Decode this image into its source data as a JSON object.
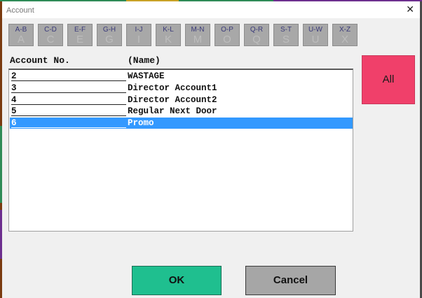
{
  "dialog": {
    "title": "Account",
    "close_glyph": "✕"
  },
  "alphabet_buttons": [
    {
      "range": "A-B",
      "letter": "A"
    },
    {
      "range": "C-D",
      "letter": "C"
    },
    {
      "range": "E-F",
      "letter": "E"
    },
    {
      "range": "G-H",
      "letter": "G"
    },
    {
      "range": "I-J",
      "letter": "I"
    },
    {
      "range": "K-L",
      "letter": "K"
    },
    {
      "range": "M-N",
      "letter": "M"
    },
    {
      "range": "O-P",
      "letter": "O"
    },
    {
      "range": "Q-R",
      "letter": "Q"
    },
    {
      "range": "S-T",
      "letter": "S"
    },
    {
      "range": "U-W",
      "letter": "U"
    },
    {
      "range": "X-Z",
      "letter": "X"
    }
  ],
  "table": {
    "columns": [
      "Account No.",
      "(Name)"
    ],
    "rows": [
      {
        "no": "2",
        "name": "WASTAGE",
        "selected": false
      },
      {
        "no": "3",
        "name": "Director Account1",
        "selected": false
      },
      {
        "no": "4",
        "name": "Director Account2",
        "selected": false
      },
      {
        "no": "5",
        "name": "Regular Next Door",
        "selected": false
      },
      {
        "no": "6",
        "name": "Promo",
        "selected": true
      }
    ]
  },
  "buttons": {
    "all": "All",
    "ok": "OK",
    "cancel": "Cancel"
  },
  "colors": {
    "all_button": "#f0406a",
    "ok_button": "#1fbf8f",
    "cancel_button": "#a6a6a6",
    "selection": "#3399ff",
    "letter_button": "#a8a8a8"
  }
}
